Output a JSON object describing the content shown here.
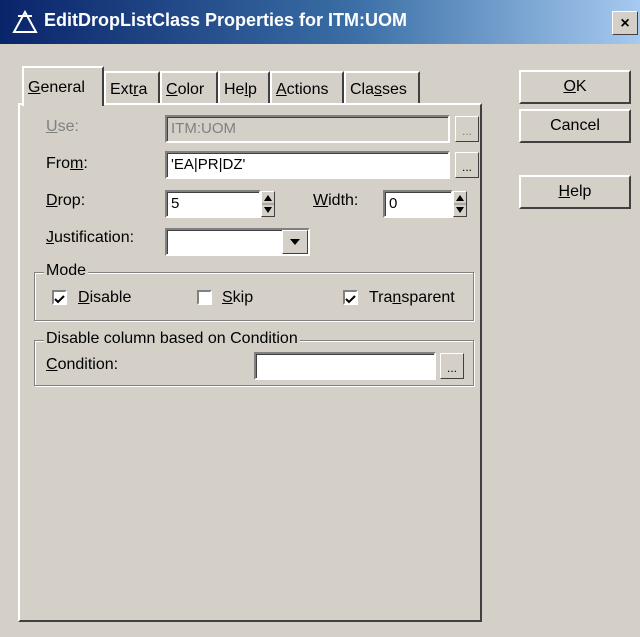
{
  "window": {
    "title": "EditDropListClass Properties for ITM:UOM",
    "close_glyph": "×"
  },
  "tabs": [
    {
      "label": "General",
      "mnemonic": "G",
      "rest": "eneral",
      "active": true
    },
    {
      "label": "Extra",
      "pre": "Ext",
      "mnemonic": "r",
      "rest": "a"
    },
    {
      "label": "Color",
      "mnemonic": "C",
      "rest": "olor"
    },
    {
      "label": "Help",
      "pre": "He",
      "mnemonic": "l",
      "rest": "p"
    },
    {
      "label": "Actions",
      "mnemonic": "A",
      "rest": "ctions"
    },
    {
      "label": "Classes",
      "pre": "Cla",
      "mnemonic": "s",
      "rest": "ses"
    }
  ],
  "form": {
    "use": {
      "label": "Use:",
      "mnemonic": "U",
      "rest": "se:",
      "value": "ITM:UOM"
    },
    "from": {
      "label": "From:",
      "pre": "Fro",
      "mnemonic": "m",
      "rest": ":",
      "value": "'EA|PR|DZ'"
    },
    "drop": {
      "label": "Drop:",
      "mnemonic": "D",
      "rest": "rop:",
      "value": "5"
    },
    "width": {
      "label": "Width:",
      "mnemonic": "W",
      "rest": "idth:",
      "value": "0"
    },
    "justification": {
      "label": "Justification:",
      "mnemonic": "J",
      "rest": "ustification:",
      "value": ""
    },
    "ellipsis": "..."
  },
  "mode": {
    "legend": "Mode",
    "disable": {
      "label": "Disable",
      "mnemonic": "D",
      "rest": "isable",
      "checked": true
    },
    "skip": {
      "label": "Skip",
      "mnemonic": "S",
      "rest": "kip",
      "checked": false
    },
    "transparent": {
      "label": "Transparent",
      "pre": "Tra",
      "mnemonic": "n",
      "rest": "sparent",
      "checked": true
    }
  },
  "condition_group": {
    "legend": "Disable column based on Condition",
    "condition": {
      "label": "Condition:",
      "mnemonic": "C",
      "rest": "ondition:",
      "value": ""
    }
  },
  "buttons": {
    "ok": {
      "label": "OK",
      "mnemonic": "O",
      "rest": "K"
    },
    "cancel": {
      "label": "Cancel"
    },
    "help": {
      "label": "Help",
      "mnemonic": "H",
      "rest": "elp"
    }
  },
  "colors": {
    "face": "#d4d0c8",
    "title_start": "#0a246a",
    "title_end": "#a6caf0",
    "disabled_text": "#808080"
  },
  "icons": [
    "app-icon",
    "close-icon",
    "ellipsis-button",
    "spin-up-icon",
    "spin-down-icon",
    "dropdown-arrow-icon",
    "checkmark-icon"
  ]
}
